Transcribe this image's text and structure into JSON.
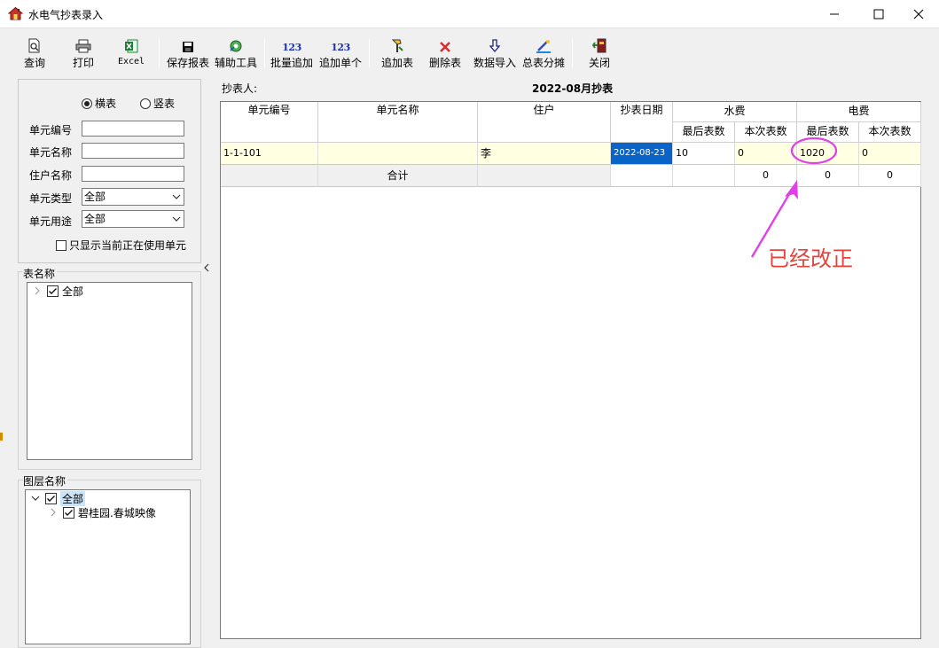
{
  "window": {
    "title": "水电气抄表录入",
    "minimize_glyph": "—",
    "maximize_glyph": "☐",
    "close_glyph": "✕"
  },
  "toolbar": {
    "buttons": [
      {
        "id": "query",
        "label": "查询",
        "icon": "search-icon"
      },
      {
        "id": "print",
        "label": "打印",
        "icon": "printer-icon"
      },
      {
        "id": "excel",
        "label": "Excel",
        "icon": "excel-icon"
      },
      {
        "id": "save-report",
        "label": "保存报表",
        "icon": "save-icon"
      },
      {
        "id": "aux-tools",
        "label": "辅助工具",
        "icon": "tools-icon"
      },
      {
        "id": "batch-add",
        "label": "批量追加",
        "icon": "number-123-icon",
        "icon_text": "123"
      },
      {
        "id": "add-single",
        "label": "追加单个",
        "icon": "number-123-icon",
        "icon_text": "123"
      },
      {
        "id": "add-meter",
        "label": "追加表",
        "icon": "add-meter-icon"
      },
      {
        "id": "delete-meter",
        "label": "删除表",
        "icon": "delete-x-icon"
      },
      {
        "id": "data-import",
        "label": "数据导入",
        "icon": "import-icon"
      },
      {
        "id": "meter-allocation",
        "label": "总表分摊",
        "icon": "allocate-icon"
      },
      {
        "id": "close",
        "label": "关闭",
        "icon": "exit-icon"
      }
    ]
  },
  "filters": {
    "radio_horizontal": "横表",
    "radio_vertical": "竖表",
    "radio_selected": "横表",
    "unit_code_label": "单元编号",
    "unit_code_value": "",
    "unit_name_label": "单元名称",
    "unit_name_value": "",
    "resident_name_label": "住户名称",
    "resident_name_value": "",
    "unit_type_label": "单元类型",
    "unit_type_value": "全部",
    "unit_use_label": "单元用途",
    "unit_use_value": "全部",
    "only_in_use_label": "只显示当前正在使用单元",
    "only_in_use_checked": false
  },
  "meter_tree": {
    "group_label": "表名称",
    "root_label": "全部",
    "root_checked": true
  },
  "layer_tree": {
    "group_label": "图层名称",
    "root_label": "全部",
    "root_checked": true,
    "child_label": "碧桂园.春城映像",
    "child_checked": true
  },
  "grid": {
    "reader_label": "抄表人:",
    "title": "2022-08月抄表",
    "headers": {
      "unit_code": "单元编号",
      "unit_name": "单元名称",
      "resident": "住户",
      "read_date": "抄表日期",
      "water": "水费",
      "electric": "电费",
      "last_reading": "最后表数",
      "current_reading": "本次表数"
    },
    "rows": [
      {
        "unit_code": "1-1-101",
        "unit_name": "",
        "resident": "李",
        "read_date": "2022-08-23",
        "water_last": "10",
        "water_current": "0",
        "electric_last": "1020",
        "electric_current": "0"
      }
    ],
    "total_row": {
      "label": "合计",
      "water_current": "0",
      "electric_last": "0",
      "electric_current": "0"
    }
  },
  "annotation": {
    "text": "已经改正",
    "color": "#e8413a",
    "highlight_color": "#e040e8"
  }
}
